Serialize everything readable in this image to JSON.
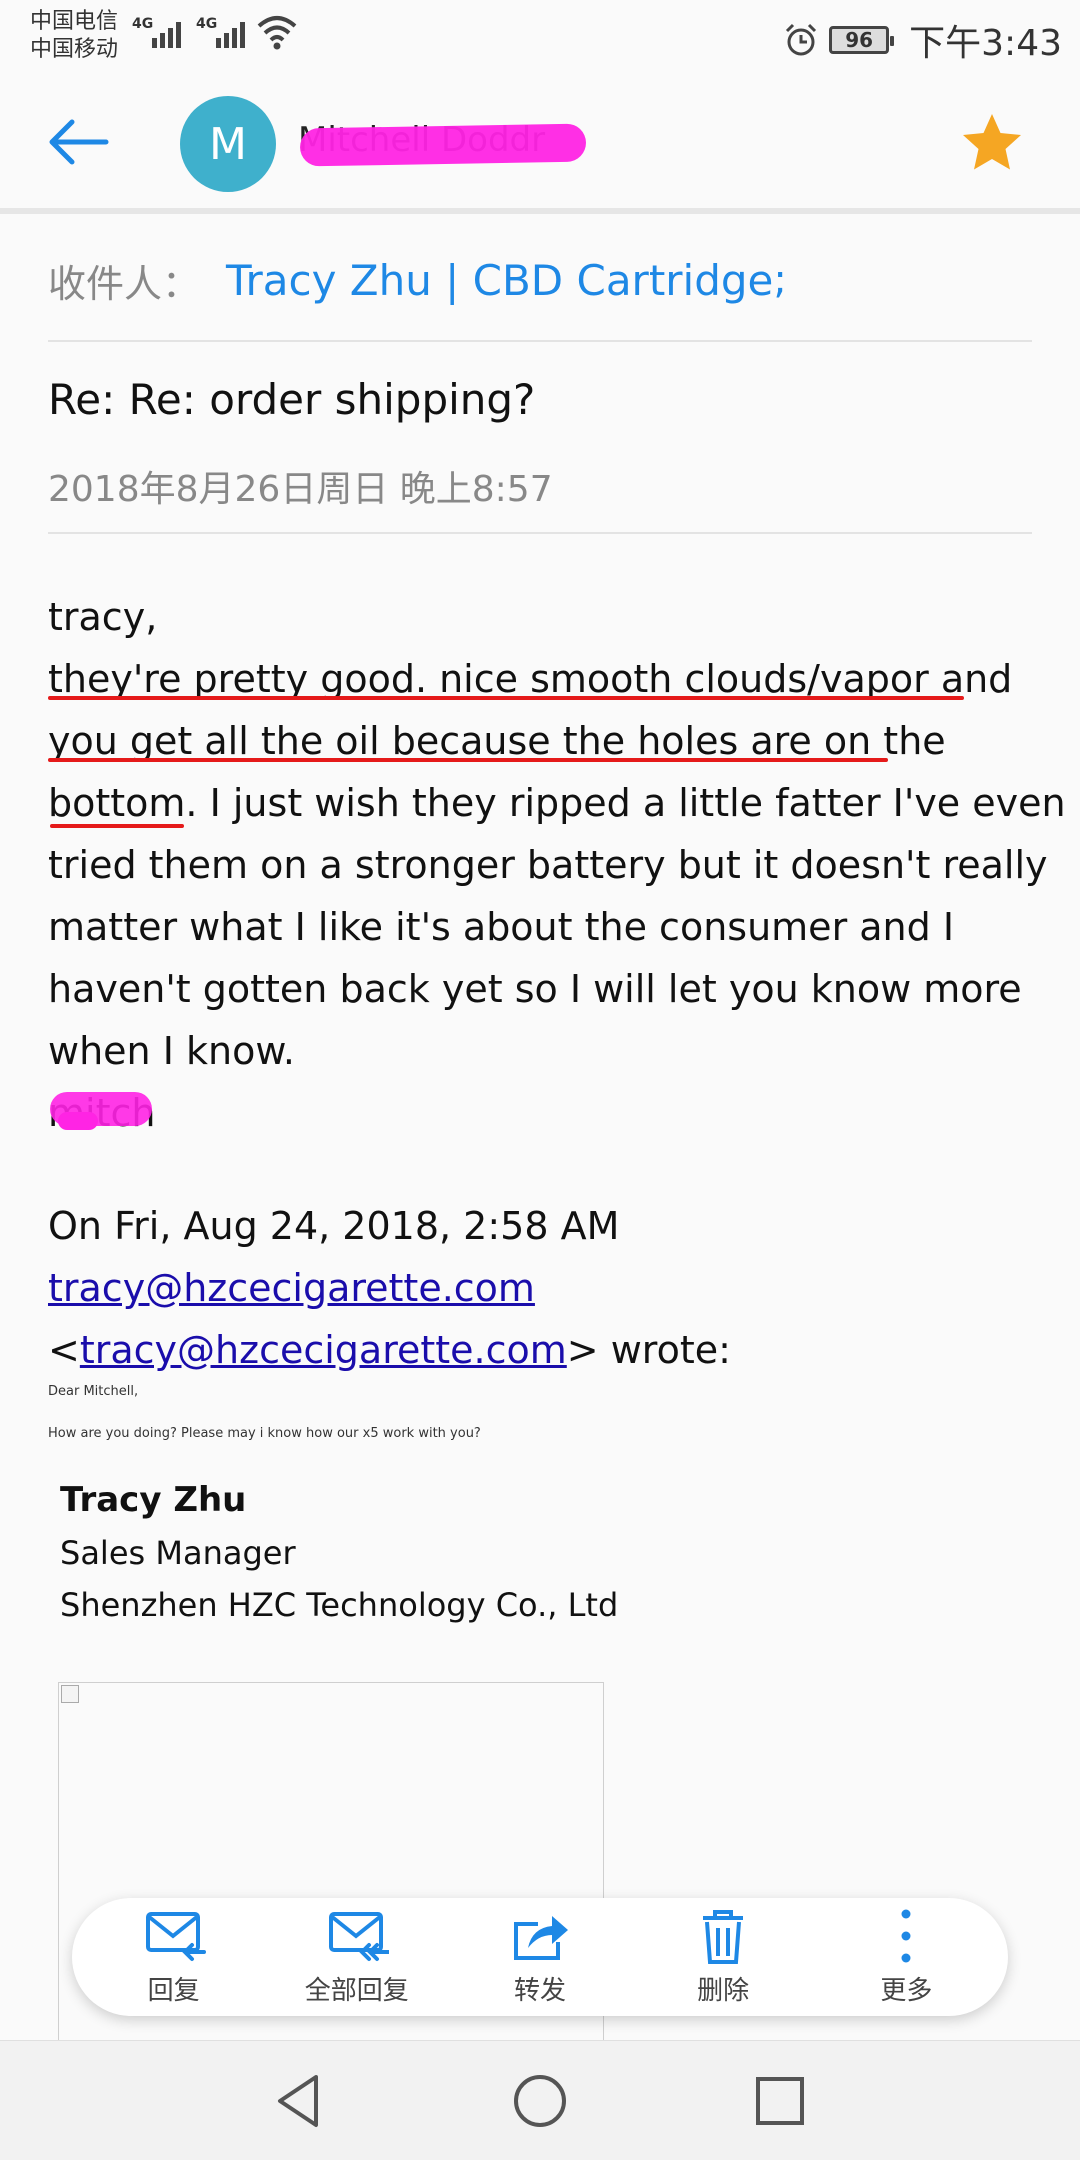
{
  "status_bar": {
    "carrier1": "中国电信",
    "carrier2": "中国移动",
    "network1": "4G",
    "network2": "4G",
    "battery": "96",
    "time": "下午3:43"
  },
  "header": {
    "avatar_letter": "M",
    "sender_name": "Mitchell Doddr"
  },
  "recipients": {
    "label": "收件人：",
    "value": "Tracy Zhu | CBD Cartridge",
    "separator": ";"
  },
  "email": {
    "subject": "Re: Re: order shipping?",
    "date": "2018年8月26日周日 晚上8:57",
    "body_lines": [
      "tracy,",
      "they're pretty good. nice smooth clouds/vapor and",
      "you get all the oil because the holes are on the",
      "bottom. I just wish they ripped a little fatter I've even",
      "tried them on a stronger battery but it doesn't really",
      "matter what I like it's about the consumer and I",
      "haven't gotten back yet so I will let you know more",
      "when I know.",
      "mitch"
    ],
    "quote": {
      "intro": "On Fri, Aug 24, 2018, 2:58 AM",
      "email_link": "tracy@hzcecigarette.com",
      "lt": "<",
      "email_link2": "tracy@hzcecigarette.com",
      "wrote": "> wrote:"
    },
    "quoted_line1": "Dear Mitchell,",
    "quoted_line2": "How are you doing? Please may i know how our x5 work with you?",
    "signature": {
      "name": "Tracy Zhu",
      "title": "Sales Manager",
      "company": "Shenzhen HZC Technology Co., Ltd"
    }
  },
  "actions": [
    {
      "label": "回复",
      "icon": "reply-icon"
    },
    {
      "label": "全部回复",
      "icon": "reply-all-icon"
    },
    {
      "label": "转发",
      "icon": "forward-icon"
    },
    {
      "label": "删除",
      "icon": "trash-icon"
    },
    {
      "label": "更多",
      "icon": "more-vertical-icon"
    }
  ],
  "colors": {
    "accent": "#1e88e5",
    "avatar": "#3fb0cc",
    "star": "#f5a623",
    "redaction": "#ff24e4",
    "underline": "#e51a1a"
  }
}
